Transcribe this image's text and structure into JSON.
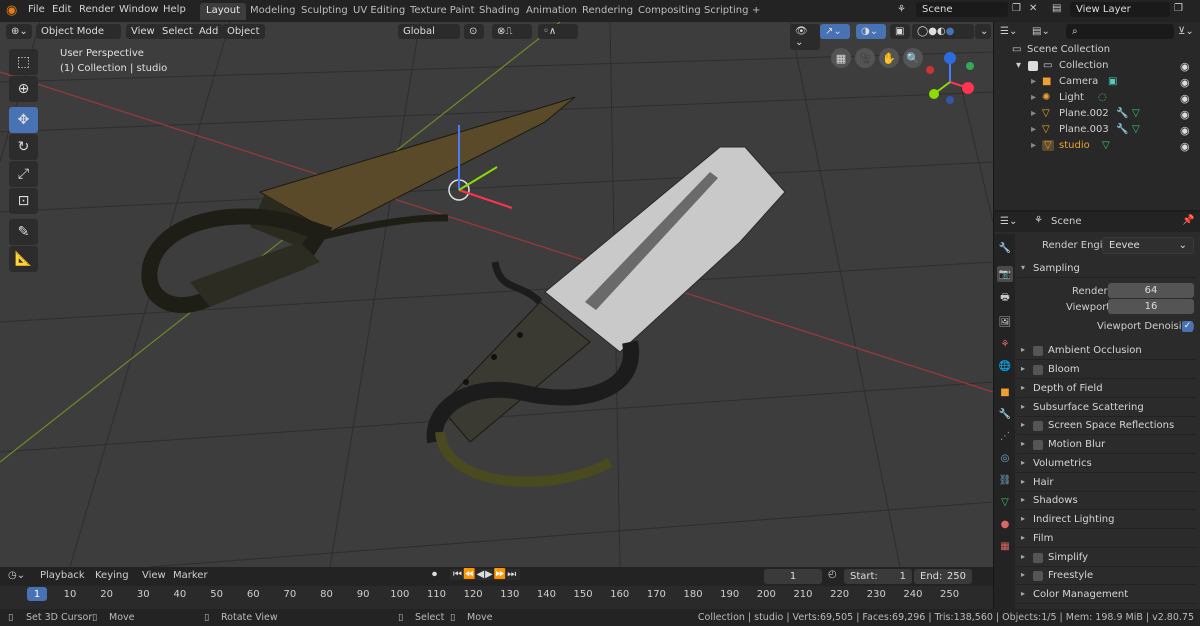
{
  "topbar": {
    "menus": [
      "File",
      "Edit",
      "Render",
      "Window",
      "Help"
    ],
    "workspaces": [
      "Layout",
      "Modeling",
      "Sculpting",
      "UV Editing",
      "Texture Paint",
      "Shading",
      "Animation",
      "Rendering",
      "Compositing",
      "Scripting"
    ],
    "active_workspace": "Layout",
    "add_tab": "+",
    "scene": "Scene",
    "view_layer": "View Layer"
  },
  "viewport_header": {
    "mode": "Object Mode",
    "menus": [
      "View",
      "Select",
      "Add",
      "Object"
    ],
    "transform_orientation": "Global"
  },
  "viewport": {
    "perspective_label": "User Perspective",
    "collection_label": "(1) Collection | studio",
    "gizmo_axes": [
      "X",
      "Y",
      "Z"
    ]
  },
  "outliner": {
    "root": "Scene Collection",
    "collection": "Collection",
    "items": [
      {
        "name": "Camera",
        "color": "#d0d0d0"
      },
      {
        "name": "Light",
        "color": "#d0d0d0"
      },
      {
        "name": "Plane.002",
        "color": "#d0d0d0"
      },
      {
        "name": "Plane.003",
        "color": "#d0d0d0"
      },
      {
        "name": "studio",
        "color": "#f0a030"
      }
    ]
  },
  "properties": {
    "context": "Scene",
    "render_engine_label": "Render Engine",
    "render_engine": "Eevee",
    "sampling": {
      "title": "Sampling",
      "render_label": "Render",
      "render": "64",
      "viewport_label": "Viewport",
      "viewport": "16",
      "denoise_label": "Viewport Denoising",
      "denoise": true
    },
    "panels": [
      {
        "label": "Ambient Occlusion",
        "checkbox": true
      },
      {
        "label": "Bloom",
        "checkbox": true
      },
      {
        "label": "Depth of Field",
        "checkbox": false
      },
      {
        "label": "Subsurface Scattering",
        "checkbox": false
      },
      {
        "label": "Screen Space Reflections",
        "checkbox": true
      },
      {
        "label": "Motion Blur",
        "checkbox": true
      },
      {
        "label": "Volumetrics",
        "checkbox": false
      },
      {
        "label": "Hair",
        "checkbox": false
      },
      {
        "label": "Shadows",
        "checkbox": false
      },
      {
        "label": "Indirect Lighting",
        "checkbox": false
      },
      {
        "label": "Film",
        "checkbox": false
      },
      {
        "label": "Simplify",
        "checkbox": true
      },
      {
        "label": "Freestyle",
        "checkbox": true
      },
      {
        "label": "Color Management",
        "checkbox": false
      }
    ]
  },
  "timeline": {
    "menus": [
      "Playback",
      "Keying",
      "View",
      "Marker"
    ],
    "current_frame": "1",
    "start_label": "Start:",
    "start": "1",
    "end_label": "End:",
    "end": "250",
    "ruler": [
      "1",
      "10",
      "20",
      "30",
      "40",
      "50",
      "60",
      "70",
      "80",
      "90",
      "100",
      "110",
      "120",
      "130",
      "140",
      "150",
      "160",
      "170",
      "180",
      "190",
      "200",
      "210",
      "220",
      "230",
      "240",
      "250"
    ]
  },
  "statusbar": {
    "hint1": "Set 3D Cursor",
    "hint2": "Move",
    "hint3": "Rotate View",
    "hint4": "Select",
    "hint5": "Move",
    "stats": "Collection | studio | Verts:69,505 | Faces:69,296 | Tris:138,560 | Objects:1/5 | Mem: 198.9 MiB | v2.80.75"
  },
  "colors": {
    "accent": "#4772b3",
    "viewport_bg": "#3d3d3d",
    "active_object": "#f0a030"
  }
}
